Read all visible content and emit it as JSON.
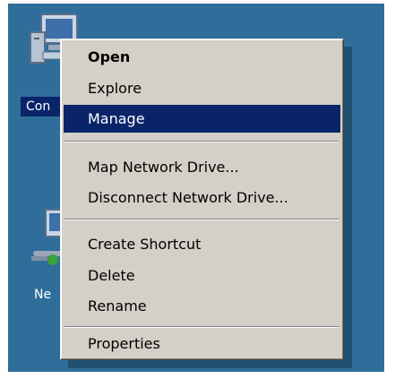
{
  "desktop": {
    "icons": [
      {
        "name": "computer",
        "label": "Con",
        "selected": true
      },
      {
        "name": "network",
        "label": "Ne",
        "selected": false
      }
    ]
  },
  "context_menu": {
    "items": [
      {
        "label": "Open",
        "bold": true
      },
      {
        "label": "Explore"
      },
      {
        "label": "Manage",
        "highlighted": true
      },
      {
        "label": "Map Network Drive..."
      },
      {
        "label": "Disconnect Network Drive..."
      },
      {
        "label": "Create Shortcut"
      },
      {
        "label": "Delete"
      },
      {
        "label": "Rename"
      },
      {
        "label": "Properties"
      }
    ]
  },
  "colors": {
    "desktop_bg": "#2f6e9a",
    "menu_bg": "#d4d0c8",
    "highlight": "#0a246a"
  }
}
